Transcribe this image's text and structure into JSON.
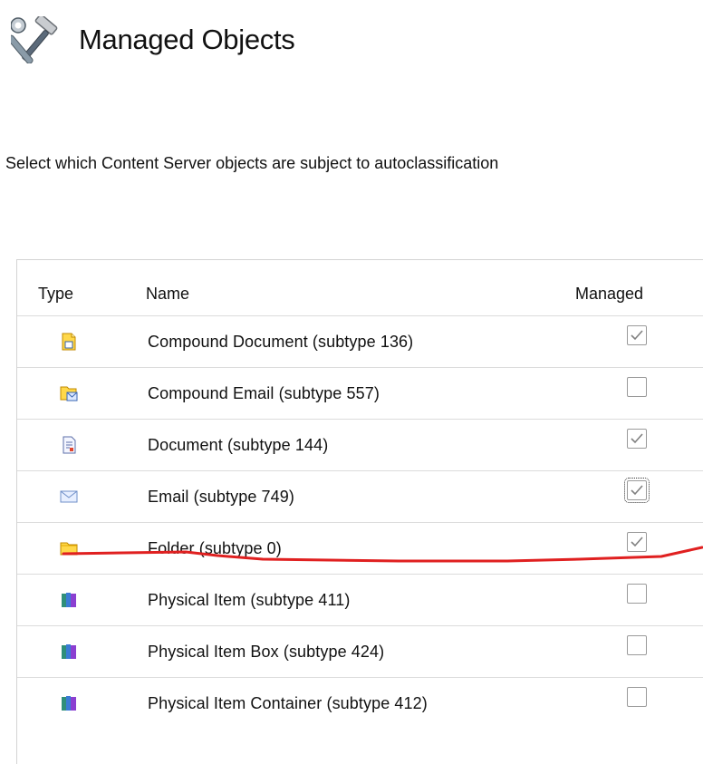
{
  "header": {
    "title": "Managed Objects",
    "icon": "tools-icon"
  },
  "description": "Select which Content Server objects are subject to autoclassification",
  "table": {
    "columns": {
      "type": "Type",
      "name": "Name",
      "managed": "Managed"
    },
    "rows": [
      {
        "icon": "compound-document-icon",
        "name": "Compound Document (subtype 136)",
        "managed": true
      },
      {
        "icon": "compound-email-icon",
        "name": "Compound Email (subtype 557)",
        "managed": false
      },
      {
        "icon": "document-icon",
        "name": "Document (subtype 144)",
        "managed": true
      },
      {
        "icon": "email-icon",
        "name": "Email (subtype 749)",
        "managed": true,
        "focused": true
      },
      {
        "icon": "folder-icon",
        "name": "Folder (subtype 0)",
        "managed": true
      },
      {
        "icon": "physical-item-icon",
        "name": "Physical Item (subtype 411)",
        "managed": false
      },
      {
        "icon": "physical-item-box-icon",
        "name": "Physical Item Box (subtype 424)",
        "managed": false
      },
      {
        "icon": "physical-item-container-icon",
        "name": "Physical Item Container (subtype 412)",
        "managed": false
      }
    ]
  },
  "colors": {
    "annotation": "#e02020",
    "checkmark": "#808080",
    "border": "#d4d4d4"
  }
}
